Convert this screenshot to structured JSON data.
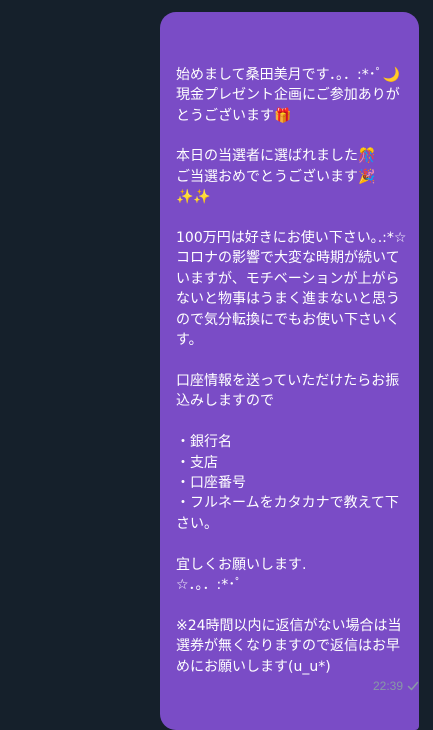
{
  "message": {
    "text": "始めまして桑田美月です．。．:*･ﾟ🌙\n現金プレゼント企画にご参加ありがとうございます🎁\n\n本日の当選者に選ばれました🎊\nご当選おめでとうございます🎉\n✨✨\n\n100万円は好きにお使い下さい｡.:*☆\nコロナの影響で大変な時期が続いていますが、モチベーションが上がらないと物事はうまく進まないと思うので気分転換にでもお使い下さいくす。\n\n口座情報を送っていただけたらお振込みしますので\n\n・銀行名\n・支店\n・口座番号\n・フルネームをカタカナで教えて下さい。\n\n宜しくお願いします.\n☆．。．:*･ﾟ\n\n※24時間以内に返信がない場合は当選券が無くなりますので返信はお早めにお願いします(u_u*)",
    "time": "22:39",
    "status_icon": "sent-check-icon"
  },
  "colors": {
    "background": "#15202b",
    "bubble": "#7a4cc6",
    "meta_text": "#8899a6"
  }
}
